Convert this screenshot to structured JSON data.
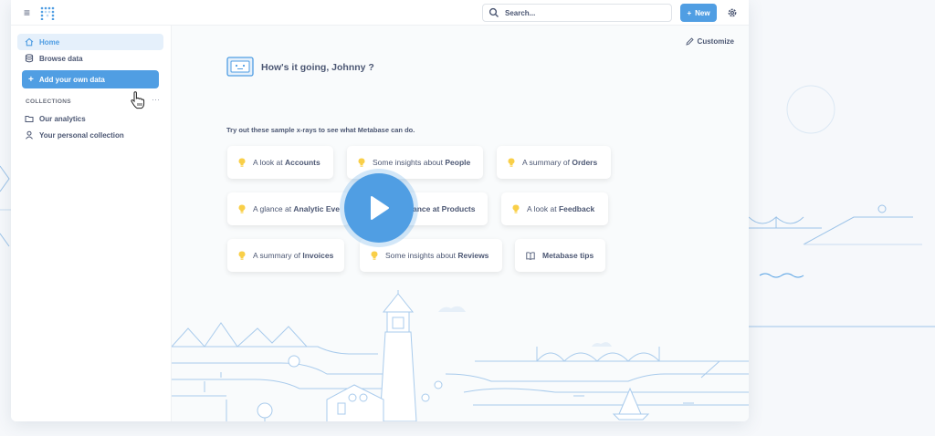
{
  "topbar": {
    "search_placeholder": "Search...",
    "new_label": "New"
  },
  "sidebar": {
    "items": [
      {
        "label": "Home",
        "icon": "home-icon",
        "active": true
      },
      {
        "label": "Browse data",
        "icon": "database-icon",
        "active": false
      }
    ],
    "add_data_label": "Add your own data",
    "collections_heading": "COLLECTIONS",
    "collections_more": "···",
    "collections": [
      {
        "label": "Our analytics",
        "icon": "folder-icon"
      },
      {
        "label": "Your personal collection",
        "icon": "person-icon"
      }
    ]
  },
  "main": {
    "customize_label": "Customize",
    "greeting": "How's it going, Johnny ?",
    "xray_intro": "Try out these sample x-rays to see what Metabase can do.",
    "cards": [
      {
        "prefix": "A look at ",
        "subject": "Accounts",
        "icon": "bulb-icon"
      },
      {
        "prefix": "Some insights about ",
        "subject": "People",
        "icon": "bulb-icon"
      },
      {
        "prefix": "A summary of ",
        "subject": "Orders",
        "icon": "bulb-icon"
      },
      {
        "prefix": "A glance at ",
        "subject": "Analytic Eve",
        "icon": "bulb-icon"
      },
      {
        "prefix": "",
        "subject": "ance at Products",
        "icon": "bulb-icon"
      },
      {
        "prefix": "A look at ",
        "subject": "Feedback",
        "icon": "bulb-icon"
      },
      {
        "prefix": "A summary of ",
        "subject": "Invoices",
        "icon": "bulb-icon"
      },
      {
        "prefix": "Some insights about ",
        "subject": "Reviews",
        "icon": "bulb-icon"
      },
      {
        "prefix": "",
        "subject": "Metabase tips",
        "icon": "book-icon"
      }
    ]
  },
  "colors": {
    "accent": "#509ee3",
    "text": "#4c5773",
    "bulb": "#f9cf48"
  }
}
